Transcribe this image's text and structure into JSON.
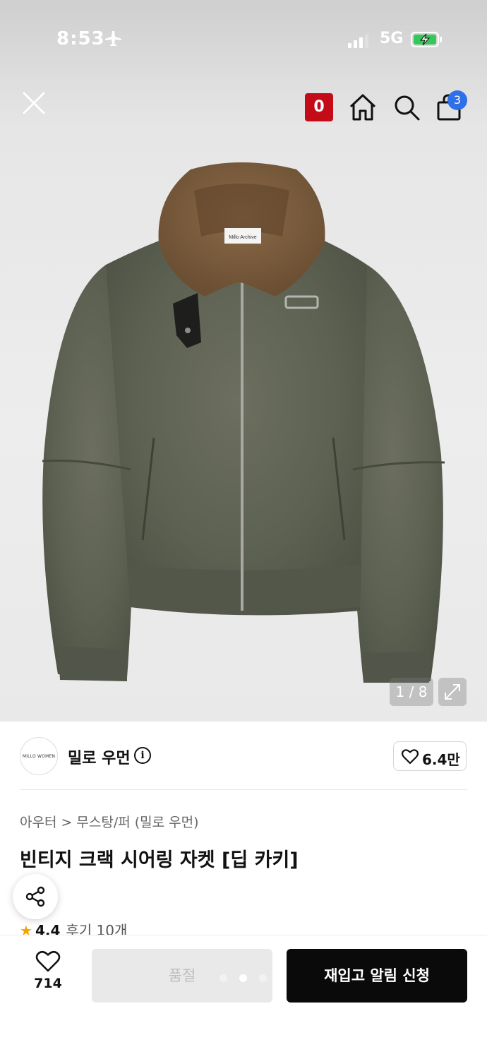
{
  "status_bar": {
    "time": "8:53",
    "network": "5G",
    "icons": [
      "airplane-icon",
      "signal-icon",
      "battery-charging-icon"
    ]
  },
  "header": {
    "reward_badge": "0",
    "cart_count": "3",
    "icons": [
      "close-icon",
      "home-icon",
      "search-icon",
      "shopping-bag-icon"
    ]
  },
  "gallery": {
    "counter": "1 / 8",
    "collar_label": "Millo Archive"
  },
  "brand": {
    "logo_text": "MILLO WOMEN",
    "name": "밀로 우먼",
    "info_symbol": "i",
    "likes": "6.4만"
  },
  "breadcrumb": {
    "category": "아우터",
    "separator": ">",
    "subcategory": "무스탕/퍼 (밀로 우먼)"
  },
  "product": {
    "title": "빈티지 크랙 시어링 자켓 [딥 카키]"
  },
  "rating": {
    "star": "★",
    "score": "4.4",
    "reviews": "후기 10개"
  },
  "bottom_bar": {
    "wishlist_count": "714",
    "soldout_label": "품절",
    "restock_label": "재입고 알림 신청"
  },
  "colors": {
    "accent": "#c40c19",
    "badge": "#2f6fe8",
    "cta": "#0a0a0a",
    "star": "#f5a300"
  }
}
